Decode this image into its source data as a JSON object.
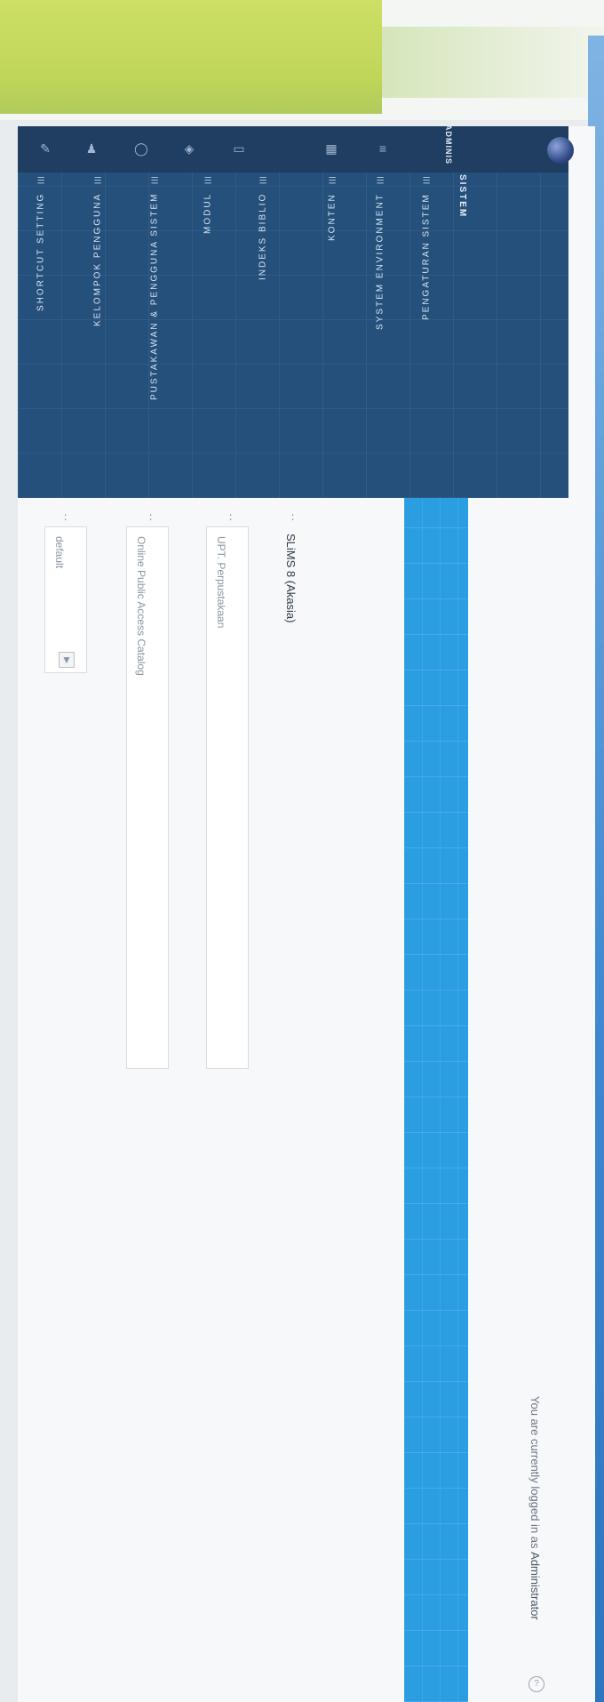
{
  "sidebar": {
    "user_label": "ADMINIS",
    "section_title": "SISTEM",
    "items": [
      {
        "label": "PENGATURAN SISTEM"
      },
      {
        "label": "SYSTEM ENVIRONMENT"
      },
      {
        "label": "KONTEN"
      },
      {
        "label": "INDEKS BIBLIO"
      },
      {
        "label": "MODUL"
      },
      {
        "label": "PUSTAKAWAN & PENGGUNA SISTEM"
      },
      {
        "label": "KELOMPOK PENGGUNA"
      },
      {
        "label": "SHORTCUT SETTING"
      }
    ]
  },
  "header": {
    "login_prefix": "You are currently logged in as",
    "login_user": "Administrator"
  },
  "form": {
    "fields": [
      {
        "colon": ":",
        "value": "SLiMS 8 (Akasia)"
      },
      {
        "colon": ":",
        "value": "UPT. Perpustakaan"
      },
      {
        "colon": ":",
        "value": "Online Public Access Catalog"
      },
      {
        "colon": ":",
        "value": "default"
      }
    ]
  },
  "colors": {
    "sidebar": "#25507c",
    "accent_bar": "#2b9ee2",
    "highlighter": "#c9dd55"
  }
}
